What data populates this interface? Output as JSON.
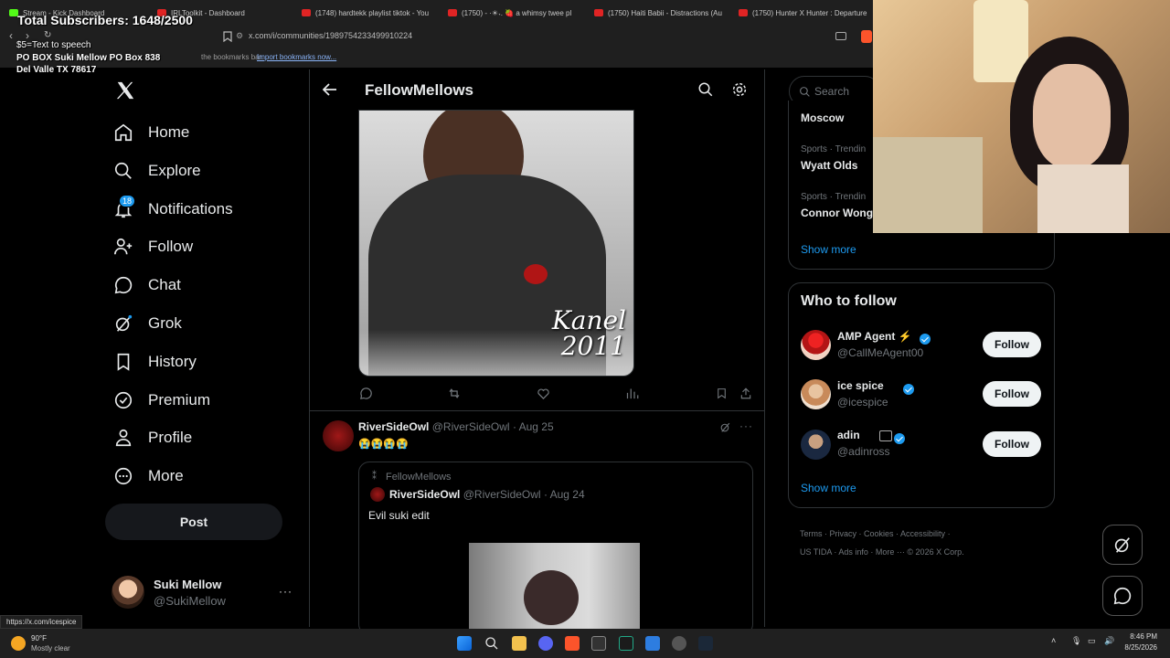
{
  "browser": {
    "tabs": [
      {
        "label": "Stream - Kick Dashboard",
        "color": "#53fc18"
      },
      {
        "label": "IRLToolkit - Dashboard",
        "color": "#e02424"
      },
      {
        "label": "(1748) hardtekk playlist tiktok - You",
        "color": "#e02424"
      },
      {
        "label": "(1750) - ·☀︎˖. 🍓 a whimsy twee pl",
        "color": "#e02424"
      },
      {
        "label": "(1750) Haiti Babii - Distractions (Au",
        "color": "#e02424"
      },
      {
        "label": "(1750) Hunter X Hunter : Departure",
        "color": "#e02424"
      }
    ],
    "url": "x.com/i/communities/1989754233499910224",
    "bookmarks_hint": "the bookmarks bar.",
    "bookmarks_import": "Import bookmarks now...",
    "status_url": "https://x.com/icespice"
  },
  "overlay": {
    "subscribers": "Total Subscribers: 1648/2500",
    "tts": "$5=Text to speech",
    "po_box": "PO BOX Suki Mellow PO Box 838",
    "address": "Del Valle TX 78617"
  },
  "sidebar": {
    "items": [
      {
        "label": "Home",
        "icon": "home-icon"
      },
      {
        "label": "Explore",
        "icon": "search-icon"
      },
      {
        "label": "Notifications",
        "icon": "bell-icon",
        "badge": "18"
      },
      {
        "label": "Follow",
        "icon": "person-add-icon"
      },
      {
        "label": "Chat",
        "icon": "chat-icon"
      },
      {
        "label": "Grok",
        "icon": "grok-icon"
      },
      {
        "label": "History",
        "icon": "bookmark-icon"
      },
      {
        "label": "Premium",
        "icon": "verified-icon"
      },
      {
        "label": "Profile",
        "icon": "person-icon"
      },
      {
        "label": "More",
        "icon": "more-icon"
      }
    ],
    "post_label": "Post",
    "account": {
      "name": "Suki Mellow",
      "handle": "@SukiMellow"
    }
  },
  "feed": {
    "title": "FellowMellows",
    "image_caption": "Kanel 2011",
    "post": {
      "author": "RiverSideOwl",
      "handle": "@RiverSideOwl",
      "date": "· Aug 25",
      "text": "😭😭😭😭",
      "quote": {
        "community": "FellowMellows",
        "author": "RiverSideOwl",
        "handle": "@RiverSideOwl",
        "date": "· Aug 24",
        "text": "Evil suki edit"
      }
    }
  },
  "right": {
    "search_placeholder": "Search",
    "trends": [
      {
        "meta": "",
        "name": "Moscow"
      },
      {
        "meta": "Sports · Trendin",
        "name": "Wyatt Olds"
      },
      {
        "meta": "Sports · Trendin",
        "name": "Connor Wong"
      }
    ],
    "show_more": "Show more",
    "who_to_follow": {
      "title": "Who to follow",
      "users": [
        {
          "name": "AMP Agent ⚡",
          "handle": "@CallMeAgent00",
          "button": "Follow"
        },
        {
          "name": "ice spice",
          "handle": "@icespice",
          "button": "Follow"
        },
        {
          "name": "adin",
          "handle": "@adinross",
          "button": "Follow"
        }
      ],
      "show_more": "Show more"
    },
    "footer": [
      "Terms",
      "Privacy",
      "Cookies",
      "Accessibility",
      "US TIDA",
      "Ads info",
      "More ···",
      "© 2026 X Corp."
    ]
  },
  "taskbar": {
    "weather_temp": "90°F",
    "weather_desc": "Mostly clear",
    "time": "8:46 PM",
    "date": "8/25/2026"
  },
  "colors": {
    "accent": "#1d9bf0",
    "background": "#000000",
    "border": "#2f3336"
  }
}
